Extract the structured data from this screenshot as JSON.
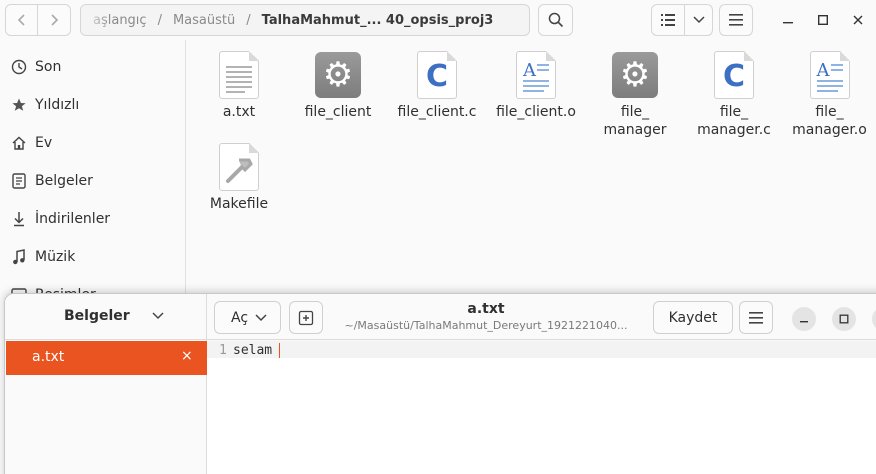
{
  "file_manager": {
    "breadcrumbs": [
      "aşlangıç",
      "Masaüstü",
      "TalhaMahmut_... 40_opsis_proj3"
    ],
    "sidebar": {
      "items": [
        {
          "label": "Son",
          "icon": "clock-icon"
        },
        {
          "label": "Yıldızlı",
          "icon": "star-icon"
        },
        {
          "label": "Ev",
          "icon": "home-icon"
        },
        {
          "label": "Belgeler",
          "icon": "document-icon"
        },
        {
          "label": "İndirilenler",
          "icon": "download-icon"
        },
        {
          "label": "Müzik",
          "icon": "music-icon"
        },
        {
          "label": "Resimler",
          "icon": "picture-icon"
        }
      ]
    },
    "files": [
      {
        "name": "a.txt",
        "icon": "text-file-icon"
      },
      {
        "name": "file_client",
        "icon": "executable-gear-icon"
      },
      {
        "name": "file_client.c",
        "icon": "c-source-icon"
      },
      {
        "name": "file_client.o",
        "icon": "object-file-icon"
      },
      {
        "name": "file_\nmanager",
        "icon": "executable-gear-icon"
      },
      {
        "name": "file_\nmanager.c",
        "icon": "c-source-icon"
      },
      {
        "name": "file_\nmanager.o",
        "icon": "object-file-icon"
      },
      {
        "name": "Makefile",
        "icon": "makefile-icon"
      }
    ]
  },
  "editor": {
    "sidebar_title": "Belgeler",
    "open_label": "Aç",
    "title": "a.txt",
    "subtitle": "~/Masaüstü/TalhaMahmut_Dereyurt_1921221040...",
    "save_label": "Kaydet",
    "documents": [
      {
        "name": "a.txt",
        "close": "×"
      }
    ],
    "lines": [
      {
        "number": "1",
        "text": "selam"
      }
    ]
  },
  "colors": {
    "accent": "#e95420",
    "c_source": "#3d6fc2",
    "gear": "#888888"
  }
}
